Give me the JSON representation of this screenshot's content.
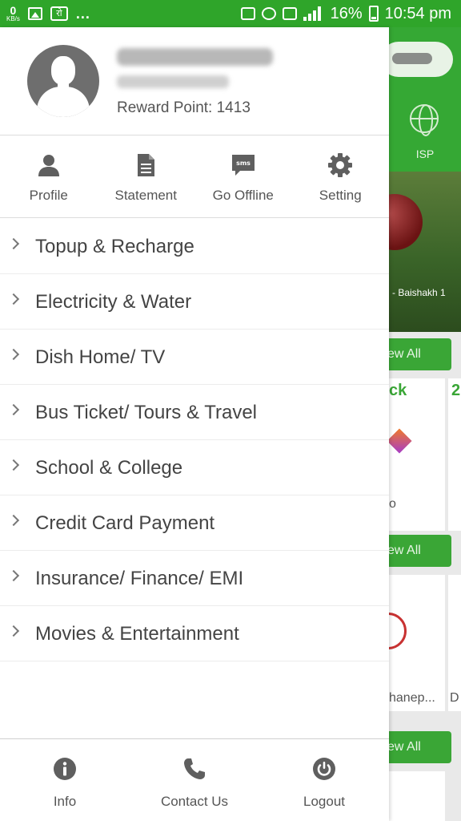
{
  "status_bar": {
    "speed_value": "0",
    "speed_unit": "KB/s",
    "left_text": "रो",
    "more": "...",
    "battery": "16%",
    "time": "10:54 pm",
    "icons": [
      "image-icon",
      "mute-icon",
      "alarm-icon",
      "wifi-call-icon",
      "signal-icon",
      "battery-icon"
    ]
  },
  "profile": {
    "reward_point": "Reward Point: 1413"
  },
  "quick_actions": [
    {
      "label": "Profile",
      "icon": "person-icon"
    },
    {
      "label": "Statement",
      "icon": "document-icon"
    },
    {
      "label": "Go Offline",
      "icon": "sms-icon"
    },
    {
      "label": "Setting",
      "icon": "gear-icon"
    }
  ],
  "menu": [
    {
      "label": "Topup & Recharge"
    },
    {
      "label": "Electricity & Water"
    },
    {
      "label": "Dish Home/ TV"
    },
    {
      "label": "Bus Ticket/ Tours & Travel"
    },
    {
      "label": "School & College"
    },
    {
      "label": "Credit Card Payment"
    },
    {
      "label": "Insurance/ Finance/ EMI"
    },
    {
      "label": "Movies & Entertainment"
    }
  ],
  "footer": [
    {
      "label": "Info",
      "icon": "info-icon"
    },
    {
      "label": "Contact Us",
      "icon": "phone-icon"
    },
    {
      "label": "Logout",
      "icon": "power-icon"
    }
  ],
  "background": {
    "isp_label": "ISP",
    "banner_text": "- Baishakh 1",
    "view_all": "ew All",
    "card_text_1": "ck",
    "card_text_2": "2",
    "card_text_3": "o",
    "card_text_4": "hanep...",
    "card_text_5": "D"
  },
  "colors": {
    "brand_green": "#2fa52a",
    "text_grey": "#555555",
    "icon_grey": "#5f5f5f"
  }
}
